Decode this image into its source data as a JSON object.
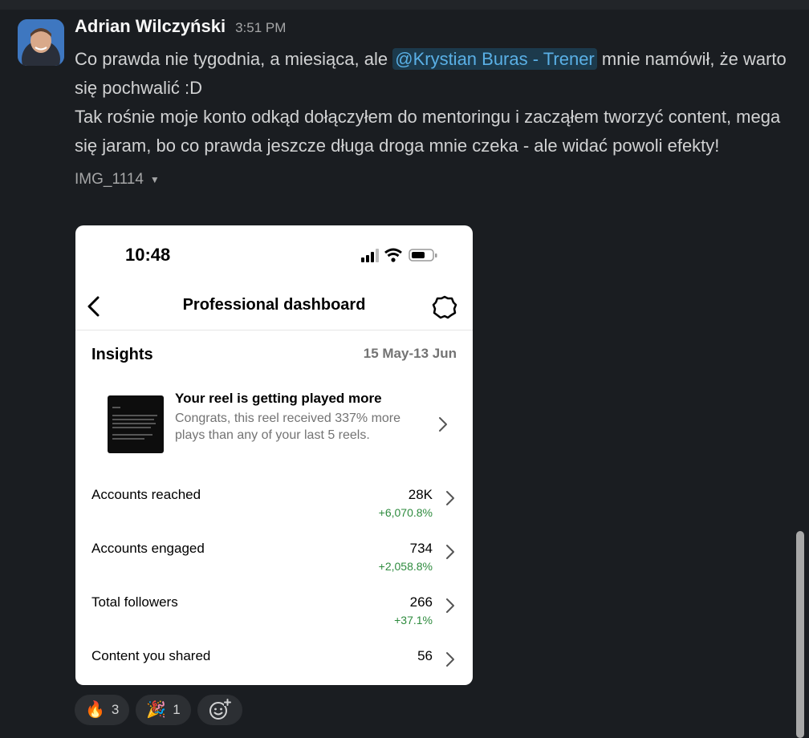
{
  "message": {
    "author": "Adrian Wilczyński",
    "timestamp": "3:51 PM",
    "text_before_mention": "Co prawda nie tygodnia, a miesiąca, ale ",
    "mention": "@Krystian Buras - Trener",
    "text_after_mention": " mnie namówił, że warto się pochwalić :D",
    "text_line2": "Tak rośnie moje konto odkąd dołączyłem do mentoringu i zacząłem tworzyć content, mega się jaram, bo co prawda jeszcze długa droga mnie czeka - ale widać powoli efekty!",
    "attachment_name": "IMG_1114",
    "avatar_icon": "user-avatar-photo"
  },
  "screenshot": {
    "status_time": "10:48",
    "title": "Professional dashboard",
    "insights_label": "Insights",
    "date_range": "15 May-13 Jun",
    "reel_heading": "Your reel is getting played more",
    "reel_description": "Congrats, this reel received 337% more plays than any of your last 5 reels.",
    "stats": [
      {
        "label": "Accounts reached",
        "value": "28K",
        "change": "+6,070.8%"
      },
      {
        "label": "Accounts engaged",
        "value": "734",
        "change": "+2,058.8%"
      },
      {
        "label": "Total followers",
        "value": "266",
        "change": "+37.1%"
      },
      {
        "label": "Content you shared",
        "value": "56",
        "change": ""
      }
    ]
  },
  "reactions": [
    {
      "emoji": "🔥",
      "icon": "fire-emoji",
      "count": "3"
    },
    {
      "emoji": "🎉",
      "icon": "party-popper-emoji",
      "count": "1"
    }
  ],
  "colors": {
    "background": "#1a1d21",
    "mention": "#5ab0e6",
    "positive_change": "#2e8b3e"
  }
}
